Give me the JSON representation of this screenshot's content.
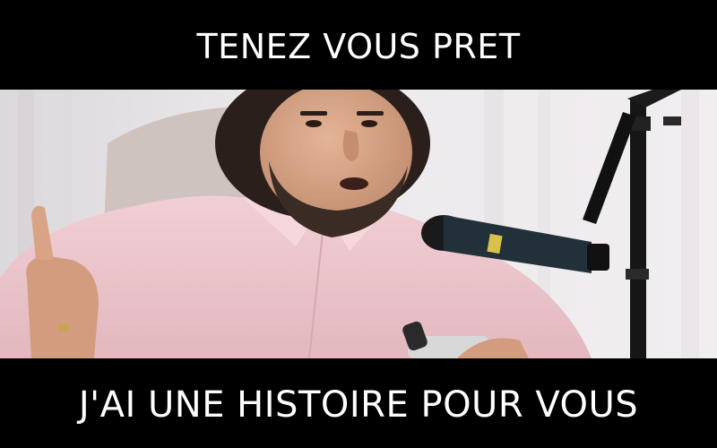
{
  "meme": {
    "top_text": "TENEZ VOUS PRET",
    "bottom_text": "J'AI UNE HISTOIRE POUR VOUS"
  },
  "colors": {
    "background": "#000000",
    "caption_text": "#ffffff",
    "wall": "#e9e6e9",
    "shirt": "#eec9cf",
    "skin": "#d7a486",
    "hair": "#2a1f1a"
  },
  "icons": {
    "microphone": "microphone-icon",
    "mic_stand": "mic-stand-icon"
  }
}
